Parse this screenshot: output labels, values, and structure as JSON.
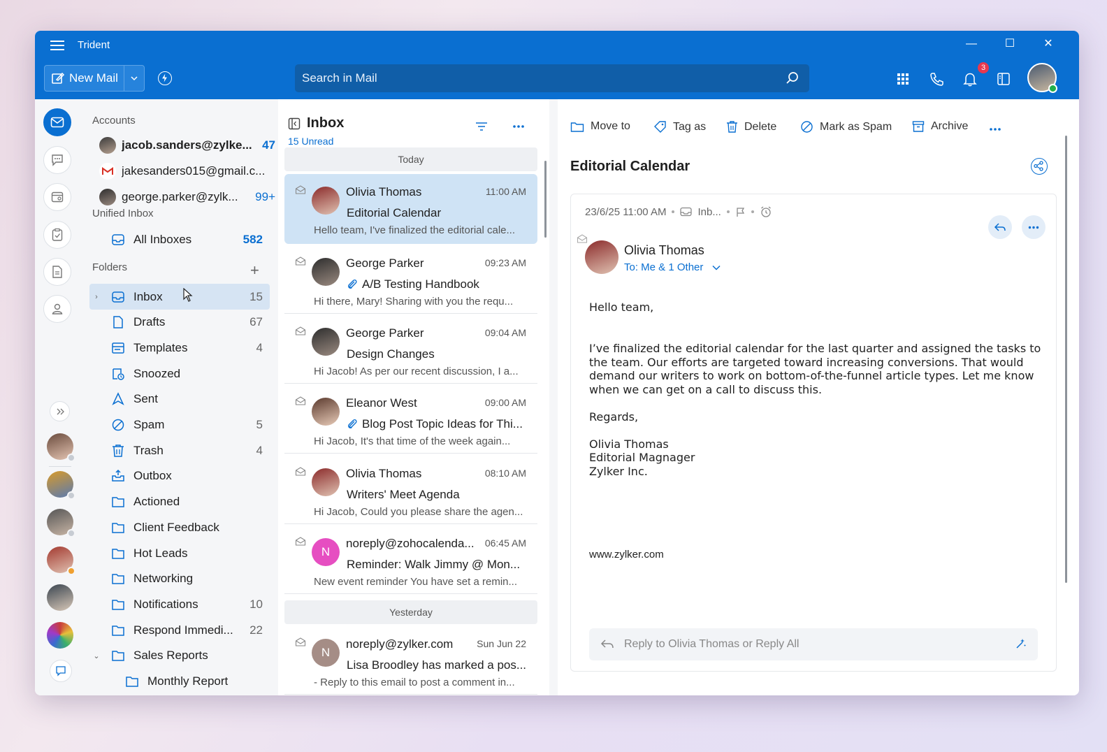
{
  "app": {
    "title": "Trident"
  },
  "toolbar": {
    "new_mail_label": "New Mail",
    "notif_count": "3"
  },
  "search": {
    "placeholder": "Search in Mail"
  },
  "sidebar": {
    "accounts_header": "Accounts",
    "accounts": [
      {
        "name": "jacob.sanders@zylke...",
        "count": "47",
        "bold": true
      },
      {
        "name": "jakesanders015@gmail.c...",
        "count": ""
      },
      {
        "name": "george.parker@zylk...",
        "count": "99+"
      }
    ],
    "unified_header": "Unified Inbox",
    "all_inboxes": {
      "label": "All Inboxes",
      "count": "582"
    },
    "folders_header": "Folders",
    "folders": [
      {
        "label": "Inbox",
        "count": "15"
      },
      {
        "label": "Drafts",
        "count": "67"
      },
      {
        "label": "Templates",
        "count": "4"
      },
      {
        "label": "Snoozed",
        "count": ""
      },
      {
        "label": "Sent",
        "count": ""
      },
      {
        "label": "Spam",
        "count": "5"
      },
      {
        "label": "Trash",
        "count": "4"
      },
      {
        "label": "Outbox",
        "count": ""
      },
      {
        "label": "Actioned",
        "count": ""
      },
      {
        "label": "Client Feedback",
        "count": ""
      },
      {
        "label": "Hot Leads",
        "count": ""
      },
      {
        "label": "Networking",
        "count": ""
      },
      {
        "label": "Notifications",
        "count": "10"
      },
      {
        "label": "Respond Immedi...",
        "count": "22"
      },
      {
        "label": "Sales Reports",
        "count": ""
      },
      {
        "label": "Monthly Report",
        "count": ""
      }
    ]
  },
  "list": {
    "title": "Inbox",
    "unread": "15 Unread",
    "today": "Today",
    "yesterday": "Yesterday",
    "mails": [
      {
        "from": "Olivia Thomas",
        "time": "11:00 AM",
        "subject": "Editorial Calendar",
        "preview": "Hello team, I've finalized the editorial cale..."
      },
      {
        "from": "George Parker",
        "time": "09:23 AM",
        "subject": "A/B Testing Handbook",
        "preview": "Hi there, Mary! Sharing with you the requ..."
      },
      {
        "from": "George Parker",
        "time": "09:04 AM",
        "subject": "Design Changes",
        "preview": "Hi Jacob! As per our recent discussion, I a..."
      },
      {
        "from": "Eleanor West",
        "time": "09:00 AM",
        "subject": "Blog Post Topic Ideas for Thi...",
        "preview": "Hi Jacob, It's that time of the week again..."
      },
      {
        "from": "Olivia Thomas",
        "time": "08:10 AM",
        "subject": "Writers' Meet Agenda",
        "preview": "Hi Jacob, Could you please share the agen..."
      },
      {
        "from": "noreply@zohocalenda...",
        "time": "06:45 AM",
        "subject": "Reminder: Walk Jimmy @ Mon...",
        "preview": "New event reminder You have set a remin...",
        "initial": "N"
      },
      {
        "from": "noreply@zylker.com",
        "time": "Sun Jun 22",
        "subject": "Lisa Broodley has marked a pos...",
        "preview": "- Reply to this email to post a comment in...",
        "initial": "N"
      }
    ]
  },
  "reader": {
    "actions": {
      "move": "Move to",
      "tag": "Tag as",
      "delete": "Delete",
      "spam": "Mark as Spam",
      "archive": "Archive"
    },
    "subject": "Editorial Calendar",
    "date": "23/6/25 11:00 AM",
    "folder": "Inb...",
    "sender": "Olivia Thomas",
    "to": "To: Me & 1 Other",
    "greeting": "Hello team,",
    "para1": "I’ve finalized the editorial calendar for the last quarter and assigned the tasks to the team. Our efforts are targeted toward increasing conversions. That would demand our writers to work on bottom-of-the-funnel article types. Let me know when we can get on a call to discuss this.",
    "regards": "Regards,",
    "sig_name": "Olivia Thomas",
    "sig_title": "Editorial Magnager",
    "sig_company": "Zylker Inc.",
    "website": "www.zylker.com",
    "reply_placeholder": "Reply to Olivia Thomas or Reply All"
  },
  "colors": {
    "accent": "#0a6fd1",
    "selected": "#cfe3f5",
    "badge": "#e8384f"
  }
}
